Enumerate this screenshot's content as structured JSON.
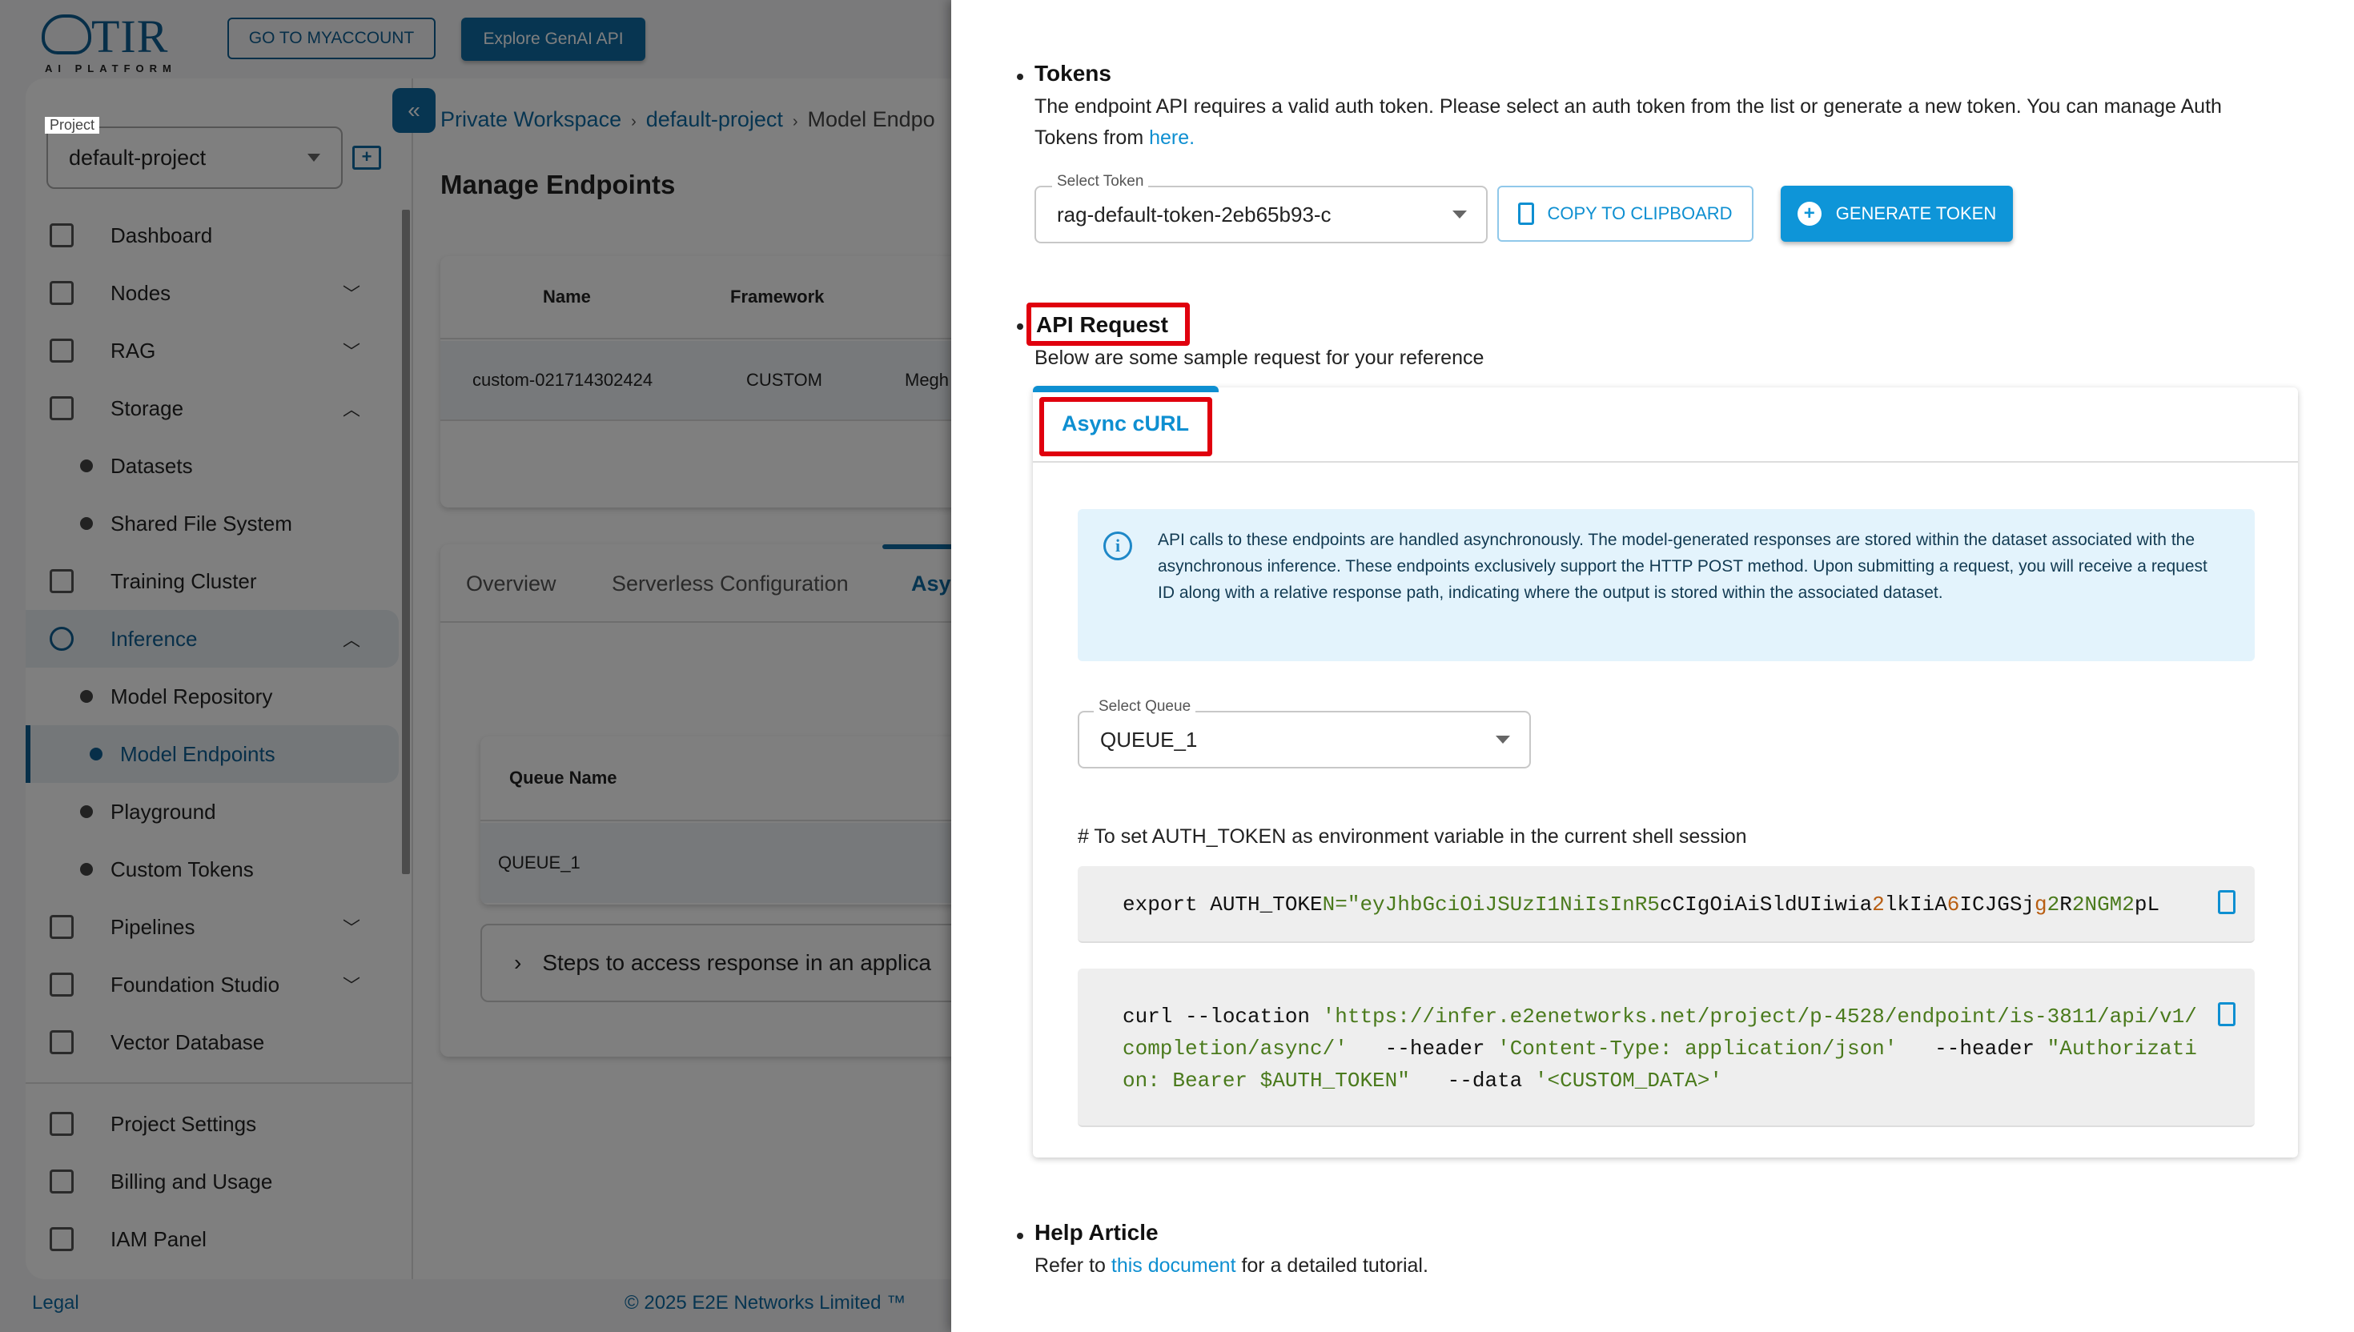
{
  "topbar": {
    "logo_text": "TIR",
    "logo_sub": "AI PLATFORM",
    "my_account_label": "GO TO MYACCOUNT",
    "explore_label": "Explore GenAI API"
  },
  "sidebar": {
    "project_label": "Project",
    "project_value": "default-project",
    "items": [
      {
        "label": "Dashboard",
        "icon": "dashboard-icon"
      },
      {
        "label": "Nodes",
        "icon": "document-icon",
        "chevron": "down"
      },
      {
        "label": "RAG",
        "icon": "robot-icon",
        "chevron": "down"
      },
      {
        "label": "Storage",
        "icon": "storage-icon",
        "chevron": "up"
      },
      {
        "label": "Datasets",
        "sub": true
      },
      {
        "label": "Shared File System",
        "sub": true
      },
      {
        "label": "Training Cluster",
        "icon": "briefcase-clock-icon"
      },
      {
        "label": "Inference",
        "icon": "inference-icon",
        "chevron": "up",
        "active_parent": true
      },
      {
        "label": "Model Repository",
        "sub": true
      },
      {
        "label": "Model Endpoints",
        "sub": true,
        "active": true
      },
      {
        "label": "Playground",
        "sub": true
      },
      {
        "label": "Custom Tokens",
        "sub": true
      },
      {
        "label": "Pipelines",
        "icon": "pipeline-icon",
        "chevron": "down"
      },
      {
        "label": "Foundation Studio",
        "icon": "studio-icon",
        "chevron": "down"
      },
      {
        "label": "Vector Database",
        "icon": "vector-icon"
      }
    ],
    "bottom_items": [
      {
        "label": "Project Settings",
        "icon": "gear-icon"
      },
      {
        "label": "Billing and Usage",
        "icon": "wallet-icon"
      },
      {
        "label": "IAM Panel",
        "icon": "shield-user-icon"
      }
    ]
  },
  "footer": {
    "legal": "Legal",
    "copyright": "© 2025 E2E Networks Limited ™"
  },
  "main": {
    "breadcrumb": [
      "Private Workspace",
      "default-project",
      "Model Endpo"
    ],
    "title": "Manage Endpoints",
    "endpoints_table": {
      "headers": [
        "Name",
        "Framework"
      ],
      "rows": [
        [
          "custom-021714302424",
          "CUSTOM",
          "Megh"
        ]
      ]
    },
    "tabs": [
      "Overview",
      "Serverless Configuration",
      "Asy"
    ],
    "queue_table": {
      "header": "Queue Name",
      "rows": [
        "QUEUE_1"
      ]
    },
    "steps_label": "Steps to access response in an applica"
  },
  "drawer": {
    "tokens": {
      "heading": "Tokens",
      "text": "The endpoint API requires a valid auth token. Please select an auth token from the list or generate a new token. You can manage Auth Tokens from ",
      "link": "here.",
      "select_label": "Select Token",
      "select_value": "rag-default-token-2eb65b93-c",
      "copy_label": "COPY TO CLIPBOARD",
      "generate_label": "GENERATE TOKEN"
    },
    "api_request": {
      "heading": "API Request",
      "subtitle": "Below are some sample request for your reference",
      "tab_label": "Async cURL",
      "info": "API calls to these endpoints are handled asynchronously. The model-generated responses are stored within the dataset associated with the asynchronous inference. These endpoints exclusively support the HTTP POST method. Upon submitting a request, you will receive a request ID along with a relative response path, indicating where the output is stored within the associated dataset.",
      "queue_label": "Select Queue",
      "queue_value": "QUEUE_1",
      "env_comment": "# To set AUTH_TOKEN as environment variable in the current shell session",
      "export_prefix": "export AUTH_TOKE",
      "export_token": "N=\"eyJhbGciOiJSUzI1NiIsInR5",
      "export_rest1": "cCIgOiAiSldUIiwia",
      "export_o1": "2",
      "export_rest2": "lkIiA",
      "export_o2": "6",
      "export_rest3": "ICJGSj",
      "export_o3": "g",
      "export_s3": "2",
      "export_rest4": "R",
      "export_s4": "2NGM2",
      "export_rest5": "pL",
      "curl_cmd": "curl --location ",
      "curl_url": "'https://infer.e2enetworks.net/project/p-4528/endpoint/is-3811/api/v1/completion/async/'",
      "curl_header1_flag": "   --header ",
      "curl_header1": "'Content-Type: application/json'",
      "curl_header2_flag": "   --header ",
      "curl_header2": "\"Authorization: Bearer $AUTH_TOKEN\"",
      "curl_data_flag": "   --data ",
      "curl_data": "'<CUSTOM_DATA>'"
    },
    "help": {
      "heading": "Help Article",
      "prefix": "Refer to ",
      "link": "this document",
      "suffix": " for a detailed tutorial."
    }
  },
  "colors": {
    "brand": "#0e6aa3",
    "accent": "#0e8fd1",
    "highlight_box": "#e0000e"
  }
}
